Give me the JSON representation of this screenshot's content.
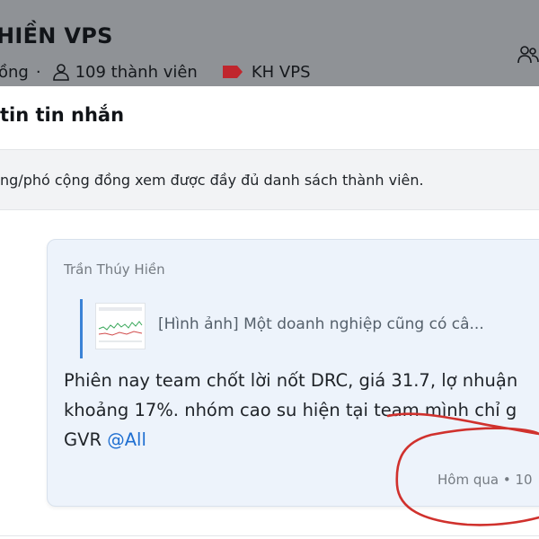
{
  "header": {
    "group_name": "HIỀN VPS",
    "status_partial": "ồng",
    "dot": "·",
    "member_count": "109 thành viên",
    "tag_label": "KH VPS",
    "tag_color": "#c0262d"
  },
  "modal": {
    "title": "tin tin nhắn",
    "notice": "ng/phó cộng đồng xem được đầy đủ danh sách thành viên."
  },
  "message": {
    "sender": "Trần Thúy Hiền",
    "quote_text": "[Hình ảnh] Một doanh nghiệp cũng có câ...",
    "body_line1": "Phiên nay team chốt lời nốt DRC, giá 31.7, lợ nhuận",
    "body_line2": "khoảng 17%. nhóm cao su hiện tại team mình chỉ g",
    "body_line3_prefix": "GVR ",
    "mention": "@All",
    "timestamp": "Hôm qua • 10",
    "accent_color": "#3b82d6",
    "mention_color": "#1f6fd1"
  },
  "annotation": {
    "color": "#d0312d",
    "icon": "red-marker-circle"
  }
}
